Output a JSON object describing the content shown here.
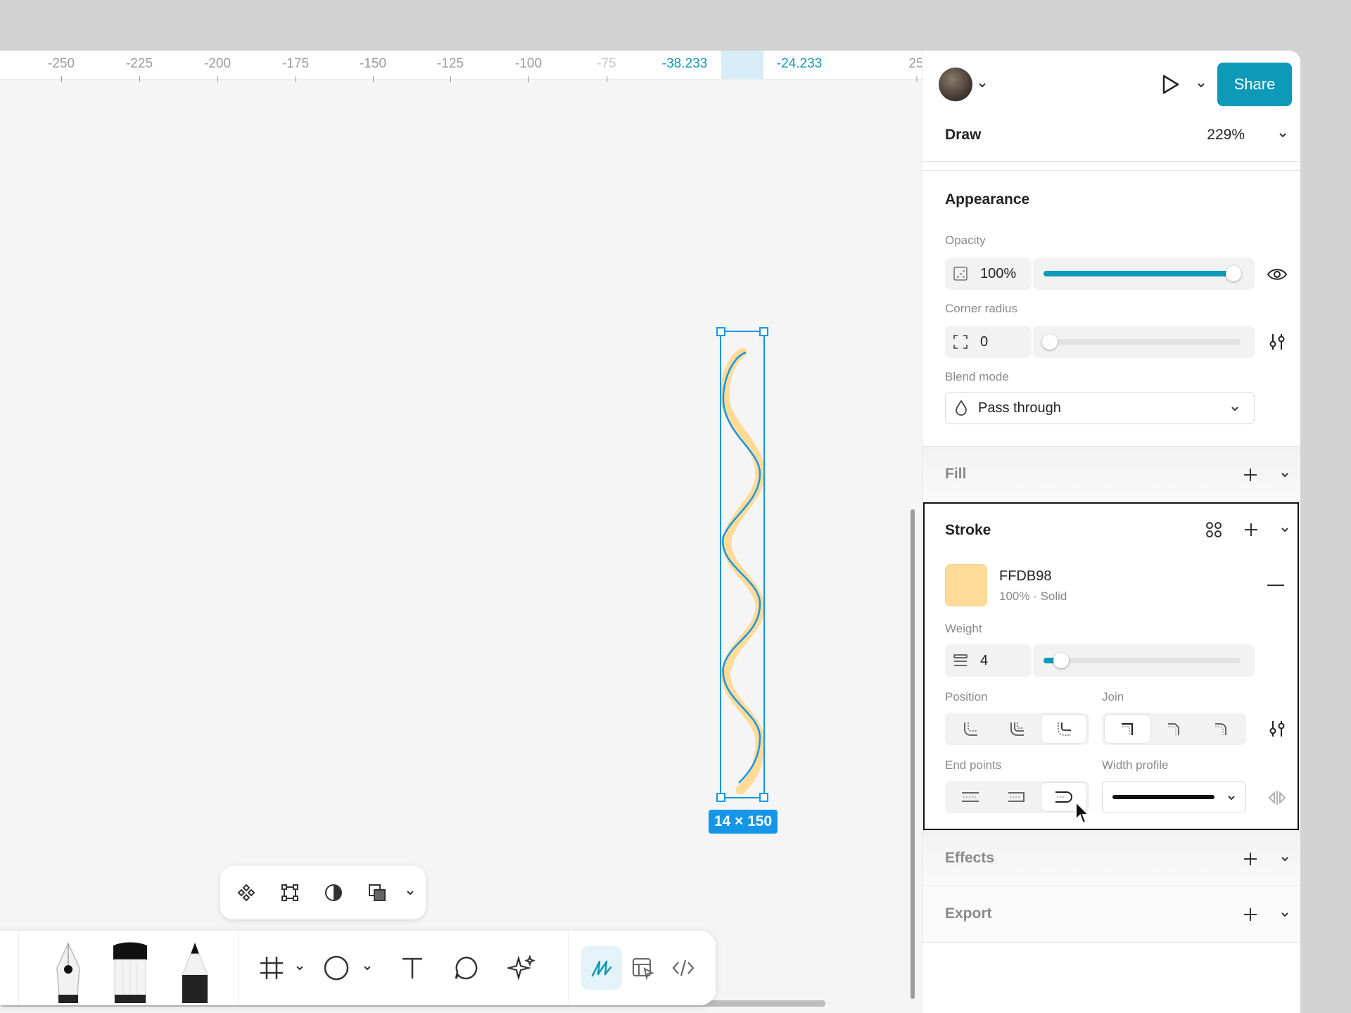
{
  "ruler": {
    "ticks": [
      "-250",
      "-225",
      "-200",
      "-175",
      "-150",
      "-125",
      "-100",
      "-75",
      "25"
    ],
    "selection_start": "-38.233",
    "selection_end": "-24.233"
  },
  "canvas": {
    "selection_size": "14 × 150",
    "stroke_color": "#FFDB98",
    "selection_color": "#1596E8"
  },
  "header": {
    "share_label": "Share",
    "mode": "Draw",
    "zoom": "229%"
  },
  "appearance": {
    "title": "Appearance",
    "opacity_label": "Opacity",
    "opacity_value": "100%",
    "opacity_fraction": 1.0,
    "corner_radius_label": "Corner radius",
    "corner_radius_value": "0",
    "blend_mode_label": "Blend mode",
    "blend_mode_value": "Pass through"
  },
  "fill": {
    "title": "Fill"
  },
  "stroke": {
    "title": "Stroke",
    "color_hex": "FFDB98",
    "color_meta": "100% · Solid",
    "weight_label": "Weight",
    "weight_value": "4",
    "position_label": "Position",
    "join_label": "Join",
    "end_points_label": "End points",
    "width_profile_label": "Width profile"
  },
  "effects": {
    "title": "Effects"
  },
  "export": {
    "title": "Export"
  },
  "colors": {
    "accent": "#0D99B8",
    "swatch": "#FFDB98"
  }
}
